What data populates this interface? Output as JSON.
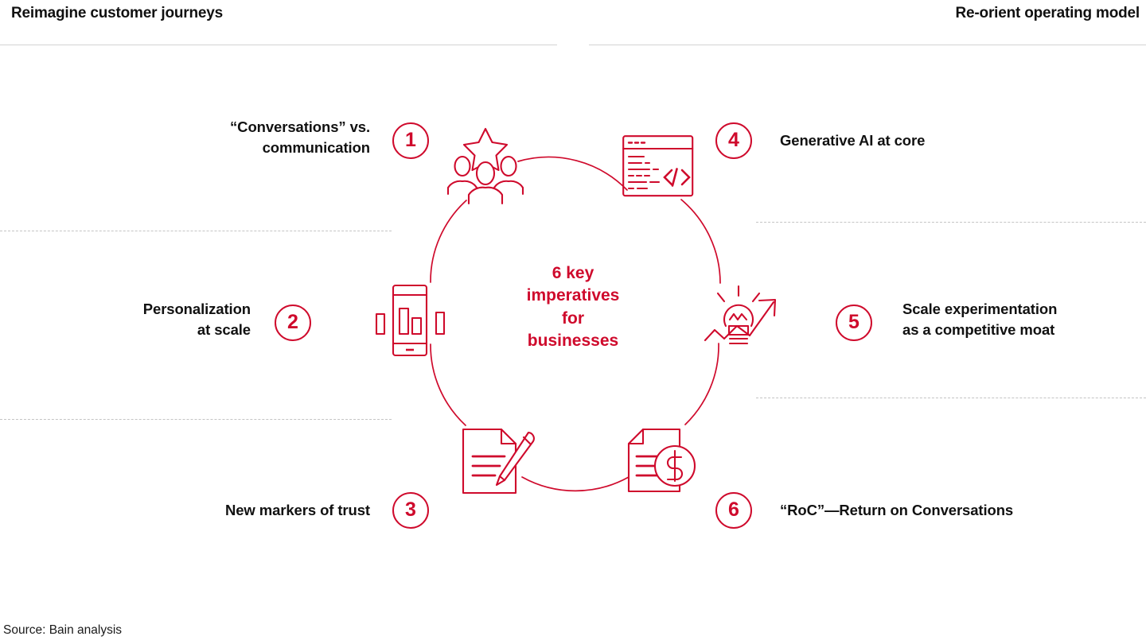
{
  "headers": {
    "left": "Reimagine customer journeys",
    "right": "Re-orient operating model"
  },
  "center": {
    "text": "6 key\nimperatives\nfor\nbusinesses",
    "color": "#cf0a2c"
  },
  "source": "Source: Bain analysis",
  "theme": {
    "accent": "#cf0a2c",
    "text": "#111111",
    "rule": "#d3d3d3",
    "dash": "#c4c4c4",
    "background": "#ffffff"
  },
  "chart_data": {
    "type": "diagram",
    "title": "6 key imperatives for businesses",
    "layout": "circular cycle with six icon nodes, three labels left, three labels right",
    "nodes": [
      {
        "number": "1",
        "label": "“Conversations” vs.\ncommunication",
        "icon": "people-group-star-icon",
        "side": "left"
      },
      {
        "number": "2",
        "label": "Personalization\nat scale",
        "icon": "mobile-bar-chart-icon",
        "side": "left"
      },
      {
        "number": "3",
        "label": "New markers of trust",
        "icon": "document-pencil-icon",
        "side": "left"
      },
      {
        "number": "4",
        "label": "Generative AI at core",
        "icon": "code-window-icon",
        "side": "right"
      },
      {
        "number": "5",
        "label": "Scale experimentation\nas a competitive moat",
        "icon": "lightbulb-growth-arrow-icon",
        "side": "right"
      },
      {
        "number": "6",
        "label": "“RoC”—Return on Conversations",
        "icon": "invoice-dollar-icon",
        "side": "right"
      }
    ]
  },
  "items": [
    {
      "number": "1",
      "label": "“Conversations” vs.\ncommunication",
      "icon_name": "people-group-star-icon"
    },
    {
      "number": "2",
      "label": "Personalization\nat scale",
      "icon_name": "mobile-bar-chart-icon"
    },
    {
      "number": "3",
      "label": "New markers of trust",
      "icon_name": "document-pencil-icon"
    },
    {
      "number": "4",
      "label": "Generative AI at core",
      "icon_name": "code-window-icon"
    },
    {
      "number": "5",
      "label": "Scale experimentation\nas a competitive moat",
      "icon_name": "lightbulb-growth-arrow-icon"
    },
    {
      "number": "6",
      "label": "“RoC”—Return on Conversations",
      "icon_name": "invoice-dollar-icon"
    }
  ]
}
